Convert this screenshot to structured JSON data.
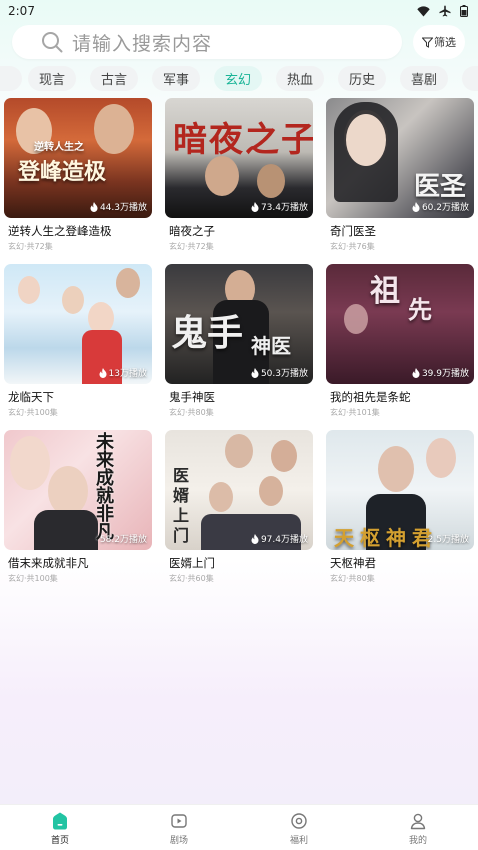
{
  "status": {
    "time": "2:07"
  },
  "search": {
    "placeholder": "请输入搜索内容"
  },
  "filter": {
    "label": "筛选"
  },
  "tabs": [
    "现言",
    "古言",
    "军事",
    "玄幻",
    "热血",
    "历史",
    "喜剧"
  ],
  "active_tab": "玄幻",
  "dramas": [
    {
      "title": "逆转人生之登峰造极",
      "meta": "玄幻·共72集",
      "plays": "44.3万播放",
      "poster_text": "逆转人生之登峰造极"
    },
    {
      "title": "暗夜之子",
      "meta": "玄幻·共72集",
      "plays": "73.4万播放",
      "poster_text": "暗夜之子"
    },
    {
      "title": "奇门医圣",
      "meta": "玄幻·共76集",
      "plays": "60.2万播放",
      "poster_text": "医圣"
    },
    {
      "title": "龙临天下",
      "meta": "玄幻·共100集",
      "plays": "13万播放",
      "poster_text": ""
    },
    {
      "title": "鬼手神医",
      "meta": "玄幻·共80集",
      "plays": "50.3万播放",
      "poster_text": "鬼手神医"
    },
    {
      "title": "我的祖先是条蛇",
      "meta": "玄幻·共101集",
      "plays": "39.9万播放",
      "poster_text": "祖先"
    },
    {
      "title": "借末来成就非凡",
      "meta": "玄幻·共100集",
      "plays": "58.2万播放",
      "poster_text": "未来成就非凡"
    },
    {
      "title": "医婿上门",
      "meta": "玄幻·共60集",
      "plays": "97.4万播放",
      "poster_text": "医婿上门"
    },
    {
      "title": "天枢神君",
      "meta": "玄幻·共80集",
      "plays": "2.5万播放",
      "poster_text": "天枢神君"
    }
  ],
  "nav": [
    {
      "label": "首页",
      "icon": "home-icon",
      "active": true
    },
    {
      "label": "剧场",
      "icon": "play-icon",
      "active": false
    },
    {
      "label": "福利",
      "icon": "coin-icon",
      "active": false
    },
    {
      "label": "我的",
      "icon": "user-icon",
      "active": false
    }
  ],
  "colors": {
    "accent": "#19b497",
    "tab_bg": "#f1f3f4",
    "tab_active_bg": "#e4f7f4"
  }
}
